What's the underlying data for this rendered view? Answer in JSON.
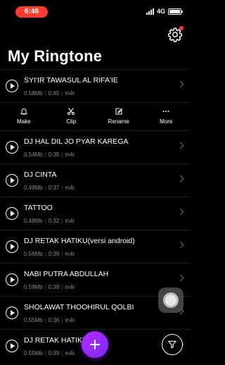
{
  "status": {
    "time": "6:46",
    "network": "4G"
  },
  "header": {
    "title": "My Ringtone"
  },
  "actions": [
    {
      "label": "Make",
      "icon": "bell-icon"
    },
    {
      "label": "Clip",
      "icon": "scissors-icon"
    },
    {
      "label": "Rename",
      "icon": "edit-icon"
    },
    {
      "label": "More",
      "icon": "more-icon"
    }
  ],
  "ringtones": [
    {
      "title": "SYI'IR TAWASUL AL RIFA'IE",
      "size": "0.58Mb",
      "duration": "0:45",
      "format": "m4r"
    },
    {
      "title": "DJ HAL DIL JO PYAR KAREGA",
      "size": "0.54Mb",
      "duration": "0:35",
      "format": "m4r"
    },
    {
      "title": "DJ CINTA",
      "size": "0.49Mb",
      "duration": "0:37",
      "format": "m4r"
    },
    {
      "title": "TATTOO",
      "size": "0.48Mb",
      "duration": "0:32",
      "format": "m4r"
    },
    {
      "title": "DJ RETAK HATIKU(versi android)",
      "size": "0.56Mb",
      "duration": "0:39",
      "format": "m4r"
    },
    {
      "title": "NABI PUTRA ABDULLAH",
      "size": "0.59Mb",
      "duration": "0:39",
      "format": "m4r"
    },
    {
      "title": "SHOLAWAT THOOHIRUL QOLBI",
      "size": "0.55Mb",
      "duration": "0:36",
      "format": "m4r"
    },
    {
      "title": "DJ RETAK HATIKU",
      "size": "0.55Mb",
      "duration": "0:39",
      "format": "m4r"
    }
  ],
  "colors": {
    "accent": "#9b2cf7",
    "notification": "#ff3b30",
    "background": "#000000"
  }
}
